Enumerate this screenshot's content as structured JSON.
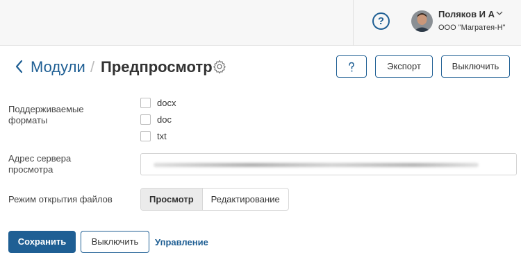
{
  "topbar": {
    "help_icon": "question-circle-icon",
    "user": {
      "name": "Поляков И А",
      "org": "ООО \"Магратея-Н\"",
      "chevron": "chevron-down-icon"
    }
  },
  "header": {
    "back_icon": "chevron-left-icon",
    "breadcrumb_link": "Модули",
    "separator": "/",
    "title": "Предпросмотр",
    "settings_icon": "gear-icon",
    "buttons": {
      "help_icon": "question-mark-icon",
      "export": "Экспорт",
      "disable": "Выключить"
    }
  },
  "form": {
    "formats": {
      "label": "Поддерживаемые форматы",
      "options": [
        {
          "label": "docx",
          "checked": false
        },
        {
          "label": "doc",
          "checked": false
        },
        {
          "label": "txt",
          "checked": false
        }
      ]
    },
    "server": {
      "label": "Адрес сервера просмотра",
      "value_redacted": true
    },
    "open_mode": {
      "label": "Режим открытия файлов",
      "options": [
        "Просмотр",
        "Редактирование"
      ],
      "selected": "Просмотр"
    }
  },
  "footer": {
    "save": "Сохранить",
    "disable": "Выключить",
    "manage": "Управление"
  },
  "colors": {
    "accent": "#1f5f94",
    "topbar_bg": "#f7f7f7",
    "segment_active_bg": "#ebebeb"
  }
}
